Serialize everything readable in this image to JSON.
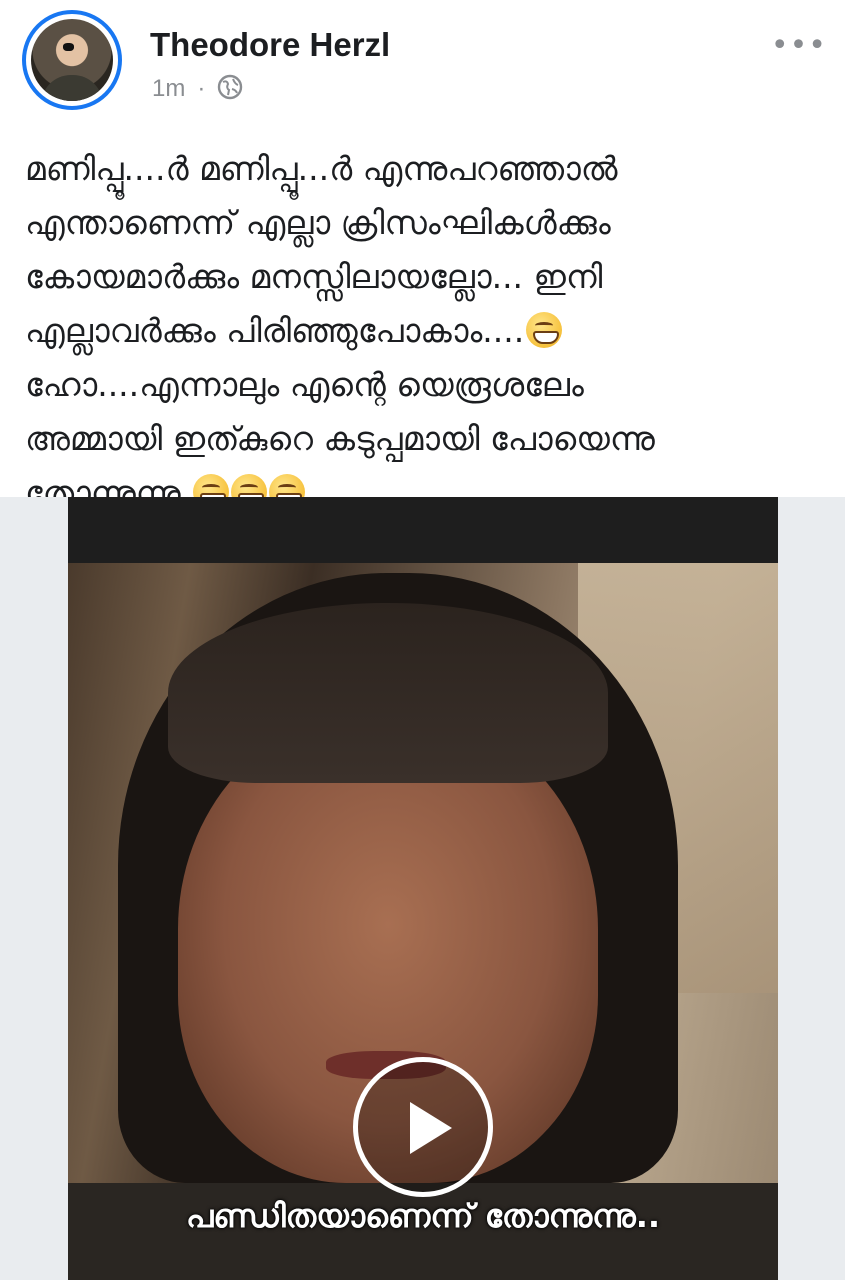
{
  "post": {
    "author_name": "Theodore Herzl",
    "timestamp": "1m",
    "separator": "·",
    "privacy_icon": "globe-icon",
    "more_options_icon": "more-options-icon",
    "text_main": "മണിപ്പൂ....ർ മണിപ്പൂ...ർ എന്നുപറഞ്ഞാൽ\nഎന്താണെന്ന് എല്ലാ ക്രിസംഘികൾക്കും\nകോയമാർക്കും മനസ്സിലായല്ലോ... ഇനി\nഎല്ലാവർക്കും പിരിഞ്ഞുപോകാം....",
    "text_line5": "ഹോ....എന്നാലും എന്റെ യെരൂശലേം",
    "text_line6": "അമ്മായി ഇത്കുറെ കടുപ്പമായി പോയെന്നു",
    "text_line7": "തോന്നുന്നു.",
    "emoji_name": "grinning-face-emoji"
  },
  "video": {
    "caption": "പണ്ഡിതയാണെന്ന് തോന്നുന്നു..",
    "play_icon": "play-icon"
  },
  "colors": {
    "avatar_ring": "#1877f2",
    "name_text": "#1c1e21",
    "meta_text": "#8a8d91"
  }
}
